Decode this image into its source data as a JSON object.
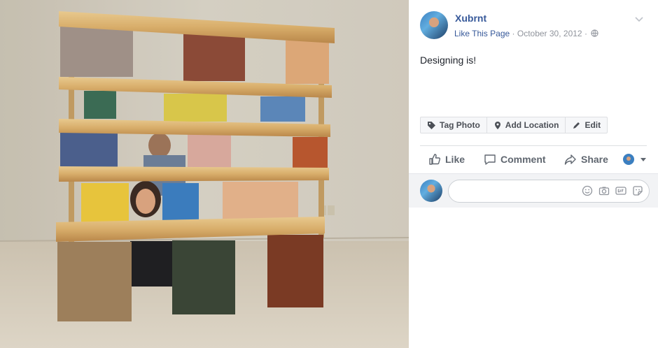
{
  "post": {
    "page_name": "Xubrnt",
    "like_link": "Like This Page",
    "separator": "·",
    "date": "October 30, 2012",
    "caption": "Designing is!"
  },
  "tag_bar": {
    "tag_photo": "Tag Photo",
    "add_location": "Add Location",
    "edit": "Edit"
  },
  "actions": {
    "like": "Like",
    "comment": "Comment",
    "share": "Share"
  },
  "icons": {
    "globe": "globe-icon",
    "chevron": "chevron-down-icon",
    "tag": "tag-icon",
    "location": "location-pin-icon",
    "edit": "pencil-icon",
    "like": "thumbs-up-icon",
    "comment": "comment-icon",
    "share": "share-icon",
    "emoji": "emoji-icon",
    "camera": "camera-icon",
    "gif": "gif-icon",
    "sticker": "sticker-icon"
  },
  "colors": {
    "link": "#365899",
    "meta": "#90949c",
    "text": "#1d2129",
    "action": "#606770"
  }
}
